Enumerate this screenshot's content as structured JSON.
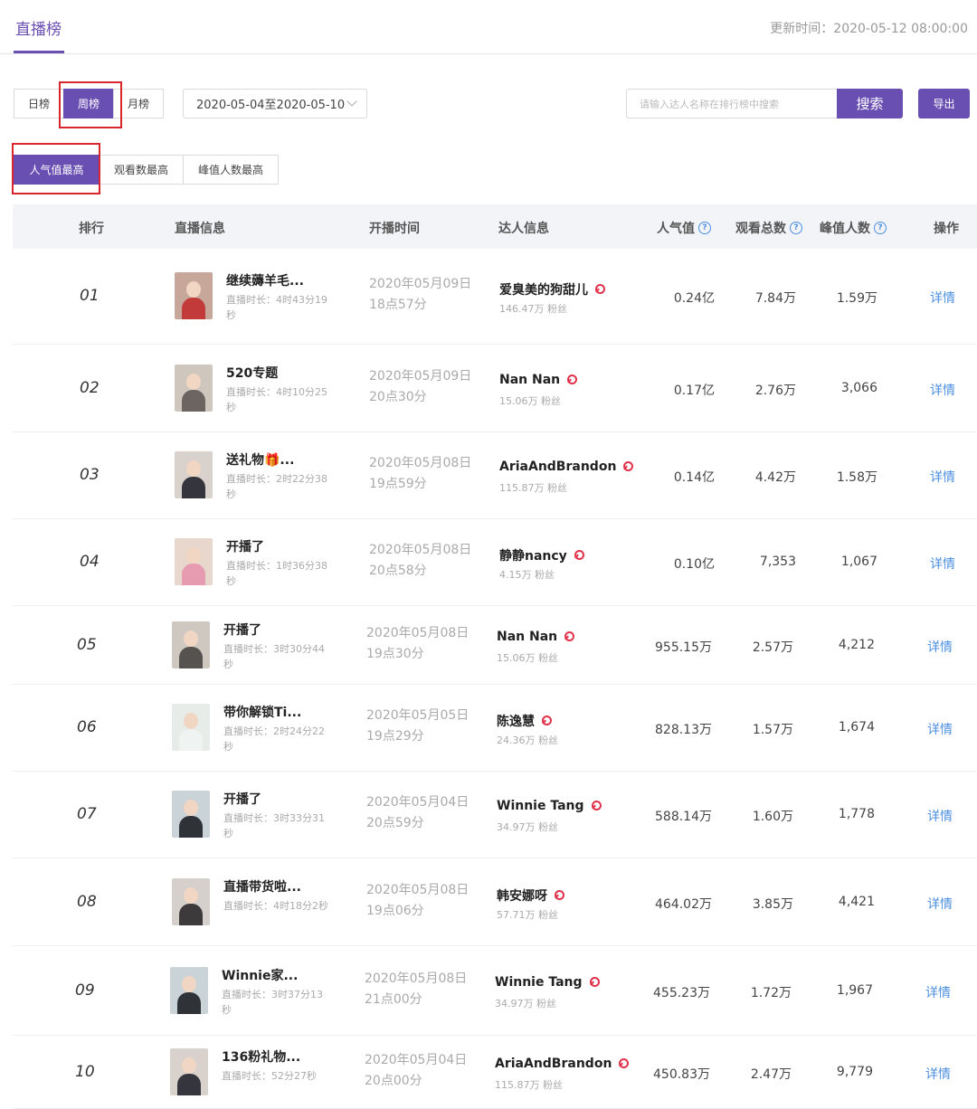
{
  "header": {
    "title": "直播榜",
    "update_time": "更新时间：2020-05-12 08:00:00"
  },
  "period_tabs": [
    {
      "label": "日榜",
      "active": false
    },
    {
      "label": "周榜",
      "active": true
    },
    {
      "label": "月榜",
      "active": false
    }
  ],
  "date_range": "2020-05-04至2020-05-10",
  "search": {
    "placeholder": "请输入达人名称在排行榜中搜索",
    "button": "搜索"
  },
  "export_label": "导出",
  "sort_tabs": [
    {
      "label": "人气值最高",
      "active": true
    },
    {
      "label": "观看数最高",
      "active": false
    },
    {
      "label": "峰值人数最高",
      "active": false
    }
  ],
  "columns": {
    "rank": "排行",
    "live": "直播信息",
    "start": "开播时间",
    "anchor": "达人信息",
    "popularity": "人气值",
    "views": "观看总数",
    "peak": "峰值人数",
    "action": "操作"
  },
  "colors": {
    "accent": "#6a4fb3",
    "link": "#4b8fe0",
    "highlight_box": "#d9262c",
    "female_icon": "#e0324a"
  },
  "rows": [
    {
      "rank": "01",
      "title": "继续薅羊毛...",
      "duration": "直播时长：4时43分19秒",
      "start_date": "2020年05月09日",
      "start_time": "18点57分",
      "anchor": "爱臭美的狗甜儿",
      "fans": "146.47万 粉丝",
      "popularity": "0.24亿",
      "views": "7.84万",
      "peak": "1.59万",
      "action": "详情"
    },
    {
      "rank": "02",
      "title": "520专题",
      "duration": "直播时长：4时10分25秒",
      "start_date": "2020年05月09日",
      "start_time": "20点30分",
      "anchor": "Nan Nan",
      "fans": "15.06万 粉丝",
      "popularity": "0.17亿",
      "views": "2.76万",
      "peak": "3,066",
      "action": "详情"
    },
    {
      "rank": "03",
      "title": "送礼物🎁...",
      "duration": "直播时长：2时22分38秒",
      "start_date": "2020年05月08日",
      "start_time": "19点59分",
      "anchor": "AriaAndBrandon",
      "fans": "115.87万 粉丝",
      "popularity": "0.14亿",
      "views": "4.42万",
      "peak": "1.58万",
      "action": "详情"
    },
    {
      "rank": "04",
      "title": "开播了",
      "duration": "直播时长：1时36分38秒",
      "start_date": "2020年05月08日",
      "start_time": "20点58分",
      "anchor": "静静nancy",
      "fans": "4.15万 粉丝",
      "popularity": "0.10亿",
      "views": "7,353",
      "peak": "1,067",
      "action": "详情"
    },
    {
      "rank": "05",
      "title": "开播了",
      "duration": "直播时长：3时30分44秒",
      "start_date": "2020年05月08日",
      "start_time": "19点30分",
      "anchor": "Nan Nan",
      "fans": "15.06万 粉丝",
      "popularity": "955.15万",
      "views": "2.57万",
      "peak": "4,212",
      "action": "详情"
    },
    {
      "rank": "06",
      "title": "带你解锁Ti...",
      "duration": "直播时长：2时24分22秒",
      "start_date": "2020年05月05日",
      "start_time": "19点29分",
      "anchor": "陈逸慧",
      "fans": "24.36万 粉丝",
      "popularity": "828.13万",
      "views": "1.57万",
      "peak": "1,674",
      "action": "详情"
    },
    {
      "rank": "07",
      "title": "开播了",
      "duration": "直播时长：3时33分31秒",
      "start_date": "2020年05月04日",
      "start_time": "20点59分",
      "anchor": "Winnie Tang",
      "fans": "34.97万 粉丝",
      "popularity": "588.14万",
      "views": "1.60万",
      "peak": "1,778",
      "action": "详情"
    },
    {
      "rank": "08",
      "title": "直播带货啦...",
      "duration": "直播时长：4时18分2秒",
      "start_date": "2020年05月08日",
      "start_time": "19点06分",
      "anchor": "韩安娜呀",
      "fans": "57.71万 粉丝",
      "popularity": "464.02万",
      "views": "3.85万",
      "peak": "4,421",
      "action": "详情"
    },
    {
      "rank": "09",
      "title": "Winnie家...",
      "duration": "直播时长：3时37分13秒",
      "start_date": "2020年05月08日",
      "start_time": "21点00分",
      "anchor": "Winnie Tang",
      "fans": "34.97万 粉丝",
      "popularity": "455.23万",
      "views": "1.72万",
      "peak": "1,967",
      "action": "详情"
    },
    {
      "rank": "10",
      "title": "136粉礼物...",
      "duration": "直播时长：52分27秒",
      "start_date": "2020年05月04日",
      "start_time": "20点00分",
      "anchor": "AriaAndBrandon",
      "fans": "115.87万 粉丝",
      "popularity": "450.83万",
      "views": "2.47万",
      "peak": "9,779",
      "action": "详情"
    }
  ]
}
